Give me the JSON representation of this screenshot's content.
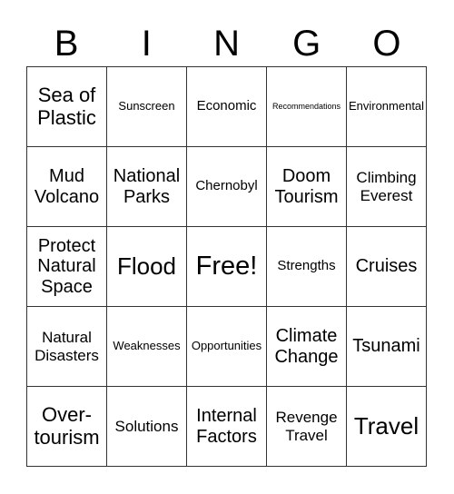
{
  "header": {
    "letters": [
      "B",
      "I",
      "N",
      "G",
      "O"
    ]
  },
  "card": {
    "cells": [
      "Sea of Plastic",
      "Sunscreen",
      "Economic",
      "Recommendations",
      "Environmental",
      "Mud Volcano",
      "National Parks",
      "Chernobyl",
      "Doom Tourism",
      "Climbing Everest",
      "Protect Natural Space",
      "Flood",
      "Free!",
      "Strengths",
      "Cruises",
      "Natural Disasters",
      "Weaknesses",
      "Opportunities",
      "Climate Change",
      "Tsunami",
      "Over-tourism",
      "Solutions",
      "Internal Factors",
      "Revenge Travel",
      "Travel"
    ],
    "free_space": "Free!"
  }
}
